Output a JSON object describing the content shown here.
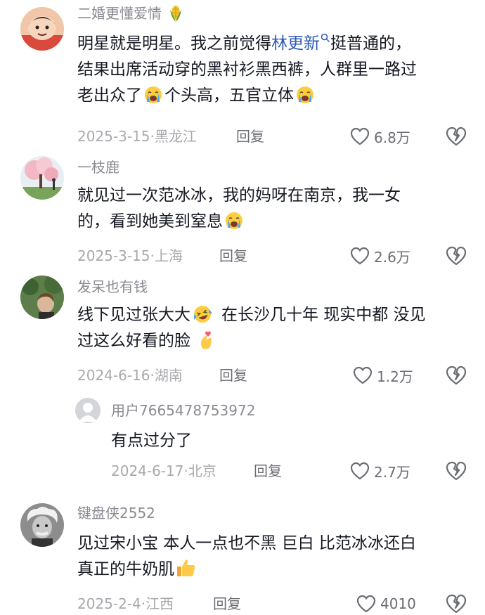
{
  "comments": [
    {
      "username": "二婚更懂爱情",
      "text": [
        [
          "明星就是明星。我之前觉得",
          "林更新",
          "挺普通的，"
        ],
        [
          "结果出席活动穿的黑衬衫黑西裤，人群里一路过"
        ],
        [
          "老出众了",
          "个头高，五官立体"
        ]
      ],
      "date": "2025-3-15",
      "location": "黑龙江",
      "reply": "回复",
      "likes": "6.8万",
      "emojis": [
        "corn",
        "crying",
        "crying"
      ],
      "avatar": "cartoon-boy"
    },
    {
      "username": "一枝鹿",
      "text": [
        [
          "就见过一次范冰冰，我的妈呀在南京，我一女"
        ],
        [
          "的，看到她美到窒息"
        ]
      ],
      "date": "2025-3-15",
      "location": "上海",
      "reply": "回复",
      "likes": "2.6万",
      "emojis": [
        "crying"
      ],
      "avatar": "blossom-tree"
    },
    {
      "username": "发呆也有钱",
      "text": [
        [
          "线下见过张大大",
          "在长沙几十年 现实中都 没见"
        ],
        [
          "过这么好看的脸"
        ]
      ],
      "date": "2024-6-16",
      "location": "湖南",
      "reply": "回复",
      "likes": "1.2万",
      "emojis": [
        "laugh-cry",
        "finger-heart"
      ],
      "avatar": "person-outdoors"
    },
    {
      "username": "用户7665478753972",
      "text": [
        [
          "有点过分了"
        ]
      ],
      "date": "2024-6-17",
      "location": "北京",
      "reply": "回复",
      "likes": "2.7万",
      "emojis": [],
      "avatar": "default-user",
      "is_reply": true
    },
    {
      "username": "键盘侠2552",
      "text": [
        [
          "见过宋小宝 本人一点也不黑 巨白 比范冰冰还白"
        ],
        [
          "真正的牛奶肌"
        ]
      ],
      "date": "2025-2-4",
      "location": "江西",
      "reply": "回复",
      "likes": "4010",
      "emojis": [
        "thumbs-up"
      ],
      "avatar": "einstein"
    }
  ],
  "icons": {
    "like": "heart-outline-icon",
    "dislike": "broken-heart-icon",
    "search_hint": "search-icon"
  },
  "colors": {
    "link": "#2b58b8",
    "username": "#8a8b91",
    "meta": "#a8a9ad"
  }
}
